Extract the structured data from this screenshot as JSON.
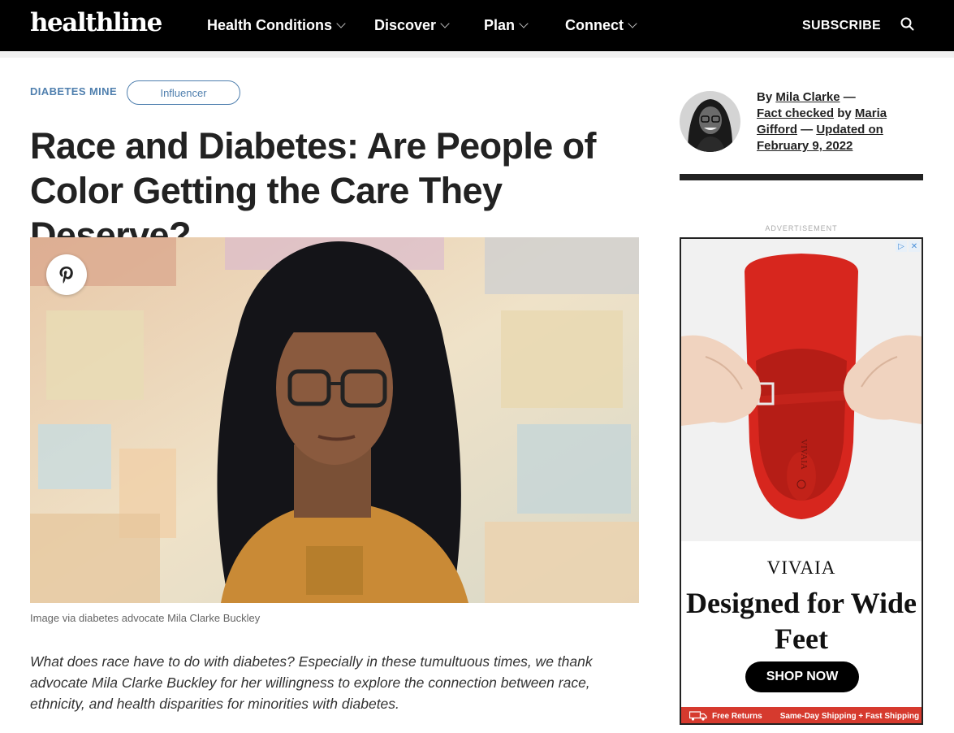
{
  "header": {
    "logo": "healthline",
    "nav": [
      {
        "label": "Health Conditions"
      },
      {
        "label": "Discover"
      },
      {
        "label": "Plan"
      },
      {
        "label": "Connect"
      }
    ],
    "subscribe": "SUBSCRIBE",
    "search_icon": "search-icon"
  },
  "article": {
    "category": "DIABETES MINE",
    "tag": "Influencer",
    "title": "Race and Diabetes: Are People of Color Getting the Care They Deserve?",
    "image_caption": "Image via diabetes advocate Mila Clarke Buckley",
    "intro": "What does race have to do with diabetes? Especially in these tumultuous times, we thank advocate Mila Clarke Buckley for her willingness to explore the connection between race, ethnicity, and health disparities for minorities with diabetes."
  },
  "author": {
    "by": "By",
    "name": "Mila Clarke",
    "dash1": "—",
    "fact_checked": "Fact checked",
    "by2": "by",
    "checker": "Maria Gifford",
    "dash2": "—",
    "updated": "Updated on February 9, 2022"
  },
  "ad": {
    "label": "ADVERTISEMENT",
    "brand": "VIVAIA",
    "headline": "Designed for Wide Feet",
    "cta": "SHOP NOW",
    "footer_left": "Free Returns",
    "footer_right": "Same-Day Shipping + Fast Shipping",
    "shoe_text": "VIVAIA",
    "choices_play": "▷",
    "choices_close": "✕"
  },
  "colors": {
    "accent": "#4f7fae",
    "header_bg": "#000000",
    "ad_red": "#d63a2e"
  }
}
